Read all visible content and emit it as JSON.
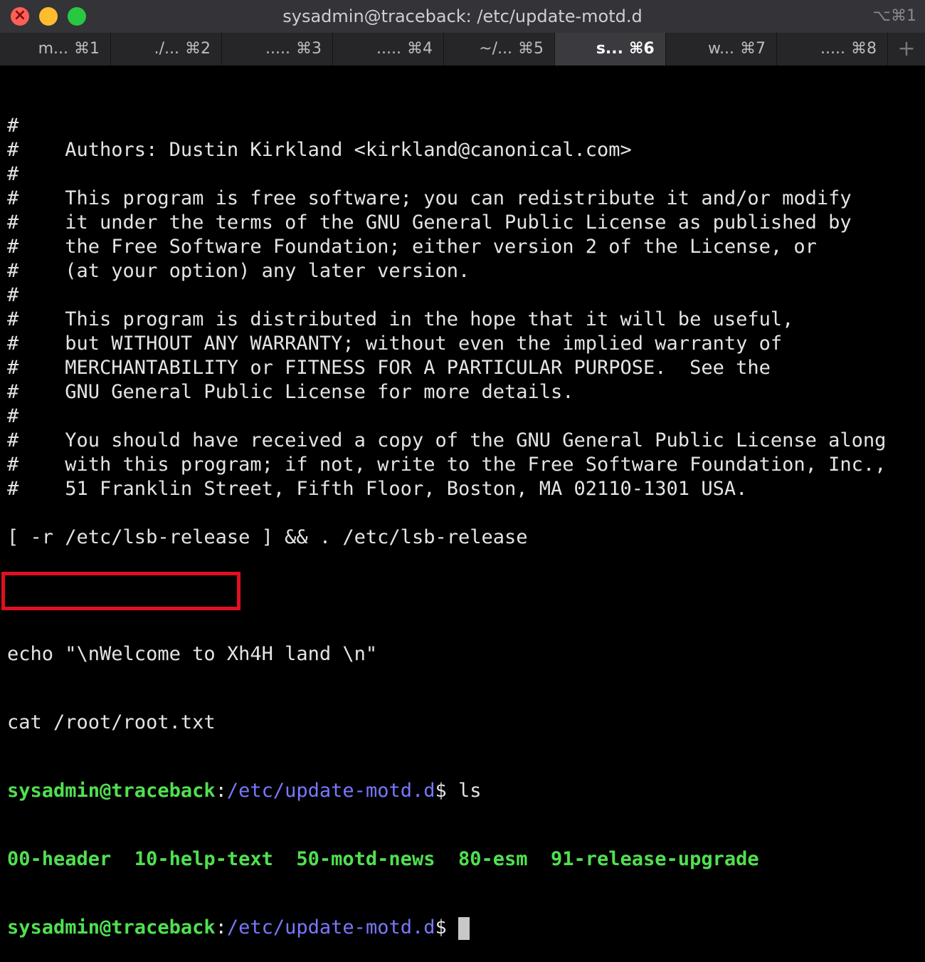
{
  "window": {
    "title": "sysadmin@traceback: /etc/update-motd.d",
    "shortcut": "⌥⌘1"
  },
  "tabs": [
    {
      "name": "m...",
      "key": "⌘1"
    },
    {
      "name": "./...",
      "key": "⌘2"
    },
    {
      "name": ".....",
      "key": "⌘3"
    },
    {
      "name": ".....",
      "key": "⌘4"
    },
    {
      "name": "~/...",
      "key": "⌘5"
    },
    {
      "name": "s...",
      "key": "⌘6"
    },
    {
      "name": "w...",
      "key": "⌘7"
    },
    {
      "name": ".....",
      "key": "⌘8"
    }
  ],
  "active_tab": 5,
  "add_tab_label": "+",
  "terminal": {
    "script_lines": [
      "#",
      "#    Authors: Dustin Kirkland <kirkland@canonical.com>",
      "#",
      "#    This program is free software; you can redistribute it and/or modify",
      "#    it under the terms of the GNU General Public License as published by",
      "#    the Free Software Foundation; either version 2 of the License, or",
      "#    (at your option) any later version.",
      "#",
      "#    This program is distributed in the hope that it will be useful,",
      "#    but WITHOUT ANY WARRANTY; without even the implied warranty of",
      "#    MERCHANTABILITY or FITNESS FOR A PARTICULAR PURPOSE.  See the",
      "#    GNU General Public License for more details.",
      "#",
      "#    You should have received a copy of the GNU General Public License along",
      "#    with this program; if not, write to the Free Software Foundation, Inc.,",
      "#    51 Franklin Street, Fifth Floor, Boston, MA 02110-1301 USA.",
      "",
      "[ -r /etc/lsb-release ] && . /etc/lsb-release",
      "",
      ""
    ],
    "echo_line": "echo \"\\nWelcome to Xh4H land \\n\"",
    "cat_line": "cat /root/root.txt",
    "prompt_user": "sysadmin@traceback",
    "prompt_sep": ":",
    "prompt_path": "/etc/update-motd.d",
    "prompt_end": "$ ",
    "command": "ls",
    "ls_output": "00-header  10-help-text  50-motd-news  80-esm  91-release-upgrade"
  },
  "colors": {
    "prompt_green": "#50e050",
    "path_blue": "#7878ff",
    "highlight_red": "#e01020"
  }
}
